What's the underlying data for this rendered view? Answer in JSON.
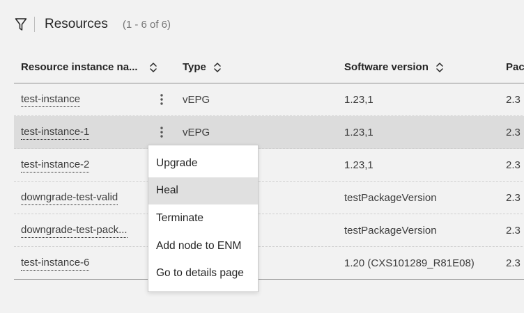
{
  "toolbar": {
    "filter_icon": "filter-funnel-icon",
    "title": "Resources",
    "count": "(1 - 6 of 6)"
  },
  "table": {
    "headers": {
      "name": "Resource instance na...",
      "type": "Type",
      "software": "Software version",
      "package": "Pac"
    },
    "rows": [
      {
        "name": "test-instance",
        "type": "vEPG",
        "software": "1.23,1",
        "package": "2.3"
      },
      {
        "name": "test-instance-1",
        "type": "vEPG",
        "software": "1.23,1",
        "package": "2.3"
      },
      {
        "name": "test-instance-2",
        "type": "",
        "software": "1.23,1",
        "package": "2.3"
      },
      {
        "name": "downgrade-test-valid",
        "type": "",
        "software": "testPackageVersion",
        "package": "2.3"
      },
      {
        "name": "downgrade-test-pack...",
        "type": "",
        "software": "testPackageVersion",
        "package": "2.3"
      },
      {
        "name": "test-instance-6",
        "type": "",
        "software": "1.20 (CXS101289_R81E08)",
        "package": "2.3"
      }
    ],
    "selected_row": 1
  },
  "context_menu": {
    "items": [
      "Upgrade",
      "Heal",
      "Terminate",
      "Add node to ENM",
      "Go to details page"
    ],
    "hovered": "Heal"
  },
  "colors": {
    "background": "#f2f2f2",
    "selected_row": "#dcdcdc",
    "menu_hover": "#e0e0e0",
    "text": "#242424"
  }
}
